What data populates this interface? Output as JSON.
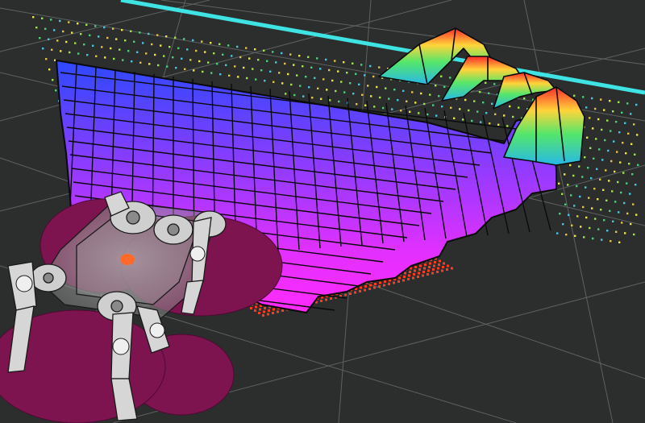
{
  "viewer": {
    "background_color": "#2c2e2e",
    "grid_color": "#5e6161",
    "walkway_color": "#3fe3e3",
    "footprint_color": "#7d1450",
    "robot_color": "#d8d8d8",
    "map_top_color": "#2d4cff",
    "map_bottom_color": "#ff28ff",
    "low_points_color": "#ff3b1f"
  },
  "visuals": {
    "elevation_grid_icon": "elevation-map-grid",
    "stairs_mesh_icon": "stairs-mesh",
    "robot_icon": "quadruped-robot-model"
  }
}
